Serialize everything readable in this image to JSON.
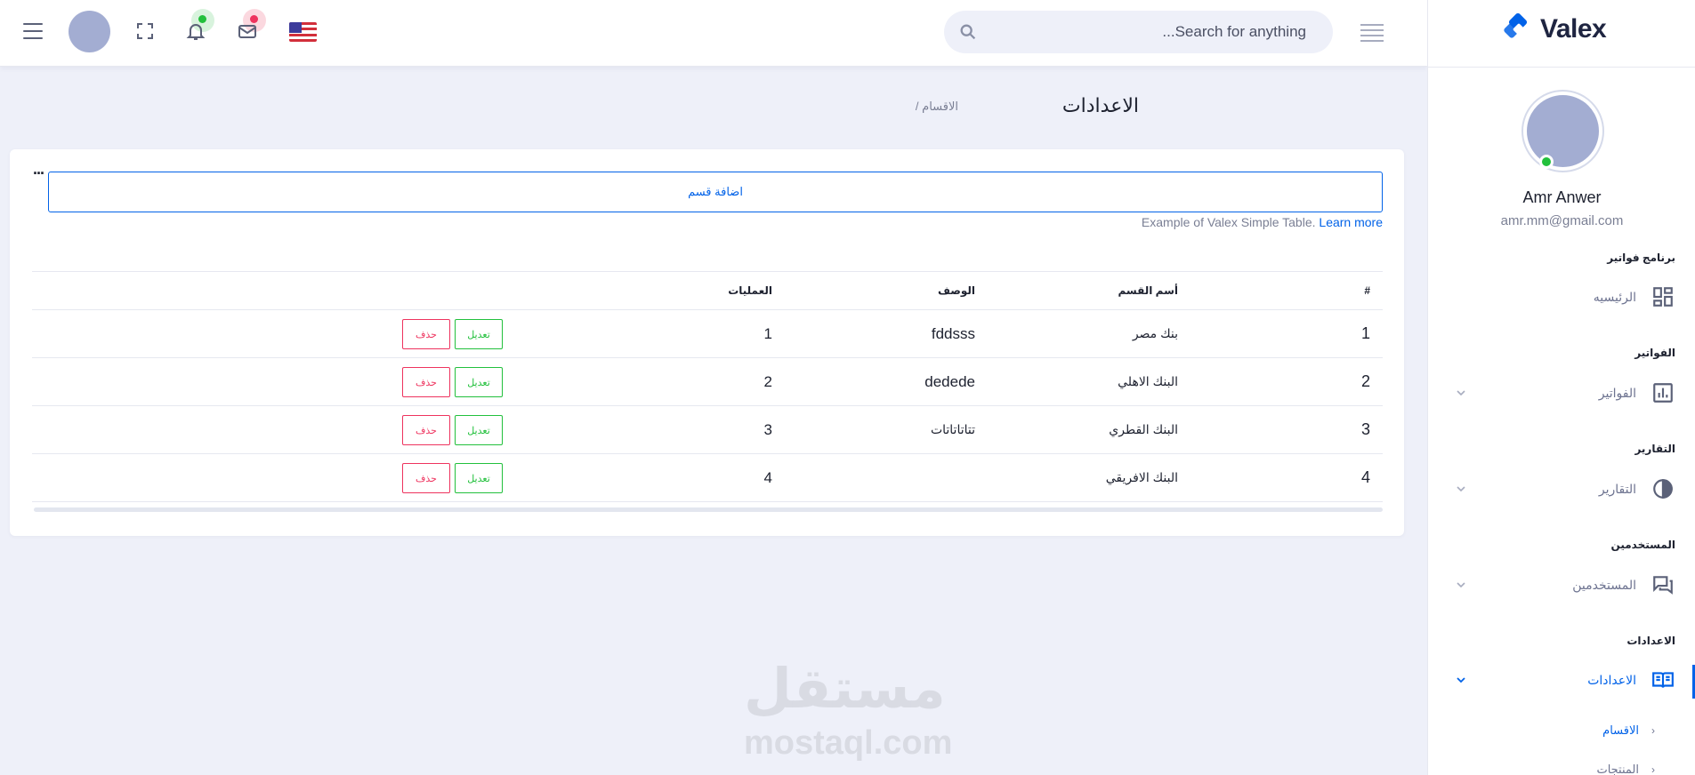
{
  "header": {
    "search_placeholder": "...Search for anything",
    "icons": [
      "menu-icon",
      "avatar",
      "fullscreen-icon",
      "bell-icon",
      "mail-icon",
      "us-flag-icon",
      "align-icon",
      "search-icon"
    ],
    "colors": {
      "notification_badge": "#22c03c",
      "mail_badge": "#ee335e"
    }
  },
  "sidebar": {
    "brand": "Valex",
    "profile": {
      "name": "Amr Anwer",
      "email": "amr.mm@gmail.com",
      "status": "online"
    },
    "sections": [
      {
        "title": "برنامج فواتير",
        "item": "الرئيسيه",
        "icon": "dashboard-icon"
      },
      {
        "title": "الفواتير",
        "item": "الفواتير",
        "icon": "bar-chart-icon"
      },
      {
        "title": "التقارير",
        "item": "التقارير",
        "icon": "pie-chart-icon"
      },
      {
        "title": "المستخدمين",
        "item": "المستخدمين",
        "icon": "chat-icon"
      },
      {
        "title": "الاعدادات",
        "item": "الاعدادات",
        "icon": "book-icon"
      }
    ],
    "sub_items": [
      "الاقسام",
      "المنتجات"
    ],
    "accent": "#0162e8"
  },
  "page": {
    "title": "الاعدادات",
    "breadcrumb": "/ الاقسام"
  },
  "card": {
    "more": "...",
    "add_button": "اضافة قسم",
    "note": "Example of Valex Simple Table.",
    "learn_more": "Learn more",
    "columns": [
      "#",
      "أسم القسم",
      "الوصف",
      "العمليات"
    ],
    "rows": [
      {
        "num": "1",
        "name": "بنك مصر",
        "desc": "fddsss",
        "op": "1"
      },
      {
        "num": "2",
        "name": "البنك الاهلي",
        "desc": "dedede",
        "op": "2"
      },
      {
        "num": "3",
        "name": "البنك القطري",
        "desc": "تتاتاتاتات",
        "op": "3"
      },
      {
        "num": "4",
        "name": "البنك الافريقي",
        "desc": "",
        "op": "4"
      }
    ],
    "edit_label": "تعديل",
    "delete_label": "حذف"
  },
  "watermark": {
    "arabic": "مستقل",
    "latin": "mostaql.com"
  }
}
